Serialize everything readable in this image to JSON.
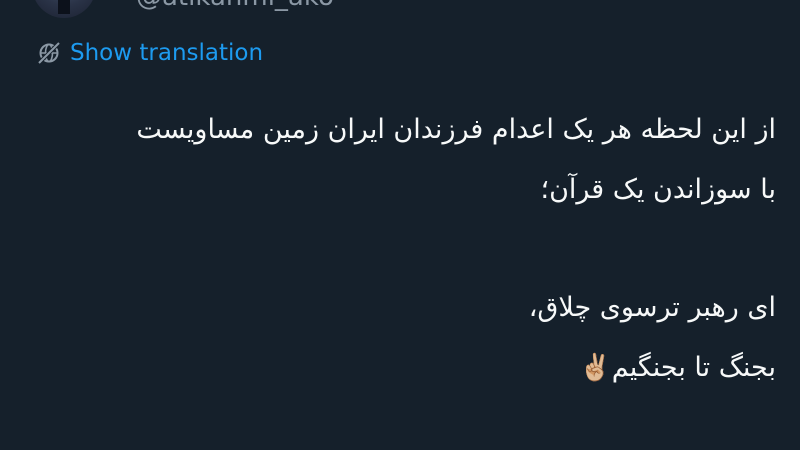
{
  "author": {
    "handle": "@atikahmi_ako"
  },
  "translation": {
    "label": "Show translation",
    "icon": "globe-slash-icon",
    "color": "#1d9bf0"
  },
  "tweet": {
    "line1": "از این لحظه هر یک اعدام فرزندان ایران زمین مساویست",
    "line2": "با سوزاندن یک قرآن؛",
    "line3": "ای رهبر ترسوی چلاق،",
    "line4": "بجنگ تا بجنگیم",
    "line4_emoji": "✌🏼"
  },
  "colors": {
    "background": "#15202b",
    "text": "#f7f9f9",
    "muted": "#8b98a5"
  }
}
